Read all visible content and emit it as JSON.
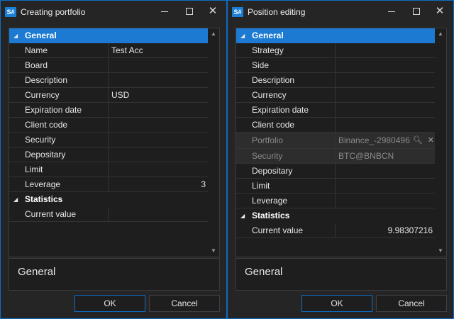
{
  "left": {
    "title": "Creating portfolio",
    "app_icon": "S#",
    "controls": {
      "min": "minimize-icon",
      "max": "maximize-icon",
      "close": "✕"
    },
    "grid": {
      "cat_general": "General",
      "cat_statistics": "Statistics",
      "rows": [
        {
          "name": "Name",
          "value": "Test Acc"
        },
        {
          "name": "Board",
          "value": ""
        },
        {
          "name": "Description",
          "value": ""
        },
        {
          "name": "Currency",
          "value": "USD"
        },
        {
          "name": "Expiration date",
          "value": ""
        },
        {
          "name": "Client code",
          "value": ""
        },
        {
          "name": "Security",
          "value": ""
        },
        {
          "name": "Depositary",
          "value": ""
        },
        {
          "name": "Limit",
          "value": ""
        },
        {
          "name": "Leverage",
          "value": "3"
        }
      ],
      "stats": [
        {
          "name": "Current value",
          "value": ""
        }
      ]
    },
    "description": "General",
    "ok": "OK",
    "cancel": "Cancel"
  },
  "right": {
    "title": "Position editing",
    "app_icon": "S#",
    "controls": {
      "min": "minimize-icon",
      "max": "maximize-icon",
      "close": "✕"
    },
    "grid": {
      "cat_general": "General",
      "cat_statistics": "Statistics",
      "rows": [
        {
          "name": "Strategy",
          "value": ""
        },
        {
          "name": "Side",
          "value": ""
        },
        {
          "name": "Description",
          "value": ""
        },
        {
          "name": "Currency",
          "value": ""
        },
        {
          "name": "Expiration date",
          "value": ""
        },
        {
          "name": "Client code",
          "value": ""
        },
        {
          "name": "Portfolio",
          "value": "Binance_-2980496!"
        },
        {
          "name": "Security",
          "value": "BTC@BNBCN"
        },
        {
          "name": "Depositary",
          "value": ""
        },
        {
          "name": "Limit",
          "value": ""
        },
        {
          "name": "Leverage",
          "value": ""
        }
      ],
      "stats": [
        {
          "name": "Current value",
          "value": "9.98307216"
        }
      ]
    },
    "description": "General",
    "ok": "OK",
    "cancel": "Cancel"
  }
}
